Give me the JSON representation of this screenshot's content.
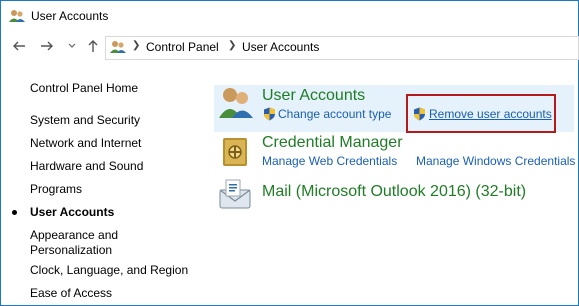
{
  "window": {
    "title": "User Accounts"
  },
  "address_bar": {
    "crumbs": [
      "Control Panel",
      "User Accounts"
    ]
  },
  "sidebar": {
    "items": [
      {
        "label": "Control Panel Home"
      },
      {
        "label": "System and Security"
      },
      {
        "label": "Network and Internet"
      },
      {
        "label": "Hardware and Sound"
      },
      {
        "label": "Programs"
      },
      {
        "label": "User Accounts",
        "current": true
      },
      {
        "label": "Appearance and"
      },
      {
        "label": "Personalization"
      },
      {
        "label": "Clock, Language, and Region"
      },
      {
        "label": "Ease of Access"
      }
    ]
  },
  "main": {
    "categories": [
      {
        "title": "User Accounts",
        "icon": "user-accounts-icon",
        "links": [
          "Change account type",
          "Remove user accounts"
        ]
      },
      {
        "title": "Credential Manager",
        "icon": "credential-manager-icon",
        "links": [
          "Manage Web Credentials",
          "Manage Windows Credentials"
        ]
      },
      {
        "title": "Mail (Microsoft Outlook 2016) (32-bit)",
        "icon": "mail-icon",
        "links": []
      }
    ]
  },
  "colors": {
    "category_title": "#1f7d26",
    "link": "#1a5fb4",
    "highlight_bg": "#e5f1fb",
    "annotation_box": "#b31b1b",
    "window_border": "#1979ca"
  }
}
